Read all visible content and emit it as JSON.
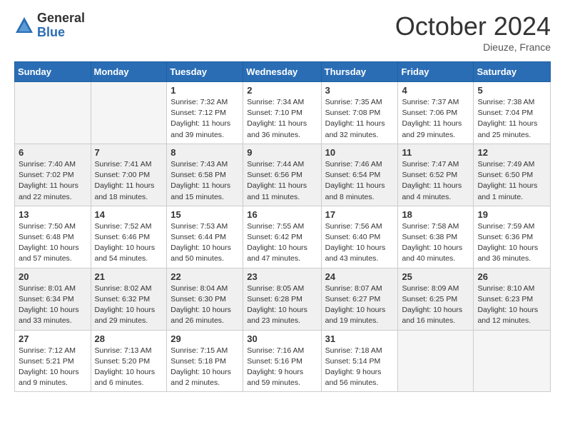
{
  "header": {
    "logo_general": "General",
    "logo_blue": "Blue",
    "month_title": "October 2024",
    "location": "Dieuze, France"
  },
  "weekdays": [
    "Sunday",
    "Monday",
    "Tuesday",
    "Wednesday",
    "Thursday",
    "Friday",
    "Saturday"
  ],
  "weeks": [
    [
      {
        "day": "",
        "info": ""
      },
      {
        "day": "",
        "info": ""
      },
      {
        "day": "1",
        "info": "Sunrise: 7:32 AM\nSunset: 7:12 PM\nDaylight: 11 hours and 39 minutes."
      },
      {
        "day": "2",
        "info": "Sunrise: 7:34 AM\nSunset: 7:10 PM\nDaylight: 11 hours and 36 minutes."
      },
      {
        "day": "3",
        "info": "Sunrise: 7:35 AM\nSunset: 7:08 PM\nDaylight: 11 hours and 32 minutes."
      },
      {
        "day": "4",
        "info": "Sunrise: 7:37 AM\nSunset: 7:06 PM\nDaylight: 11 hours and 29 minutes."
      },
      {
        "day": "5",
        "info": "Sunrise: 7:38 AM\nSunset: 7:04 PM\nDaylight: 11 hours and 25 minutes."
      }
    ],
    [
      {
        "day": "6",
        "info": "Sunrise: 7:40 AM\nSunset: 7:02 PM\nDaylight: 11 hours and 22 minutes."
      },
      {
        "day": "7",
        "info": "Sunrise: 7:41 AM\nSunset: 7:00 PM\nDaylight: 11 hours and 18 minutes."
      },
      {
        "day": "8",
        "info": "Sunrise: 7:43 AM\nSunset: 6:58 PM\nDaylight: 11 hours and 15 minutes."
      },
      {
        "day": "9",
        "info": "Sunrise: 7:44 AM\nSunset: 6:56 PM\nDaylight: 11 hours and 11 minutes."
      },
      {
        "day": "10",
        "info": "Sunrise: 7:46 AM\nSunset: 6:54 PM\nDaylight: 11 hours and 8 minutes."
      },
      {
        "day": "11",
        "info": "Sunrise: 7:47 AM\nSunset: 6:52 PM\nDaylight: 11 hours and 4 minutes."
      },
      {
        "day": "12",
        "info": "Sunrise: 7:49 AM\nSunset: 6:50 PM\nDaylight: 11 hours and 1 minute."
      }
    ],
    [
      {
        "day": "13",
        "info": "Sunrise: 7:50 AM\nSunset: 6:48 PM\nDaylight: 10 hours and 57 minutes."
      },
      {
        "day": "14",
        "info": "Sunrise: 7:52 AM\nSunset: 6:46 PM\nDaylight: 10 hours and 54 minutes."
      },
      {
        "day": "15",
        "info": "Sunrise: 7:53 AM\nSunset: 6:44 PM\nDaylight: 10 hours and 50 minutes."
      },
      {
        "day": "16",
        "info": "Sunrise: 7:55 AM\nSunset: 6:42 PM\nDaylight: 10 hours and 47 minutes."
      },
      {
        "day": "17",
        "info": "Sunrise: 7:56 AM\nSunset: 6:40 PM\nDaylight: 10 hours and 43 minutes."
      },
      {
        "day": "18",
        "info": "Sunrise: 7:58 AM\nSunset: 6:38 PM\nDaylight: 10 hours and 40 minutes."
      },
      {
        "day": "19",
        "info": "Sunrise: 7:59 AM\nSunset: 6:36 PM\nDaylight: 10 hours and 36 minutes."
      }
    ],
    [
      {
        "day": "20",
        "info": "Sunrise: 8:01 AM\nSunset: 6:34 PM\nDaylight: 10 hours and 33 minutes."
      },
      {
        "day": "21",
        "info": "Sunrise: 8:02 AM\nSunset: 6:32 PM\nDaylight: 10 hours and 29 minutes."
      },
      {
        "day": "22",
        "info": "Sunrise: 8:04 AM\nSunset: 6:30 PM\nDaylight: 10 hours and 26 minutes."
      },
      {
        "day": "23",
        "info": "Sunrise: 8:05 AM\nSunset: 6:28 PM\nDaylight: 10 hours and 23 minutes."
      },
      {
        "day": "24",
        "info": "Sunrise: 8:07 AM\nSunset: 6:27 PM\nDaylight: 10 hours and 19 minutes."
      },
      {
        "day": "25",
        "info": "Sunrise: 8:09 AM\nSunset: 6:25 PM\nDaylight: 10 hours and 16 minutes."
      },
      {
        "day": "26",
        "info": "Sunrise: 8:10 AM\nSunset: 6:23 PM\nDaylight: 10 hours and 12 minutes."
      }
    ],
    [
      {
        "day": "27",
        "info": "Sunrise: 7:12 AM\nSunset: 5:21 PM\nDaylight: 10 hours and 9 minutes."
      },
      {
        "day": "28",
        "info": "Sunrise: 7:13 AM\nSunset: 5:20 PM\nDaylight: 10 hours and 6 minutes."
      },
      {
        "day": "29",
        "info": "Sunrise: 7:15 AM\nSunset: 5:18 PM\nDaylight: 10 hours and 2 minutes."
      },
      {
        "day": "30",
        "info": "Sunrise: 7:16 AM\nSunset: 5:16 PM\nDaylight: 9 hours and 59 minutes."
      },
      {
        "day": "31",
        "info": "Sunrise: 7:18 AM\nSunset: 5:14 PM\nDaylight: 9 hours and 56 minutes."
      },
      {
        "day": "",
        "info": ""
      },
      {
        "day": "",
        "info": ""
      }
    ]
  ]
}
